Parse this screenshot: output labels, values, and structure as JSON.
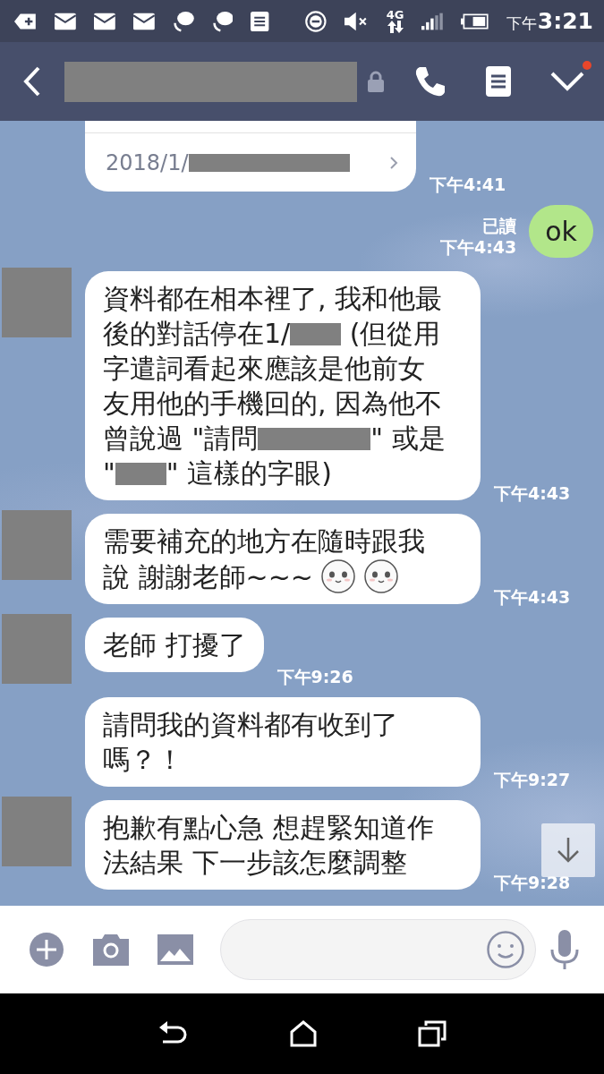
{
  "status_bar": {
    "network": "4G",
    "period": "下午",
    "time": "3:21"
  },
  "header": {
    "has_unread": true
  },
  "messages": [
    {
      "kind": "card",
      "avatar": false,
      "lines": [
        [
          {
            "kind": "text",
            "text": "2018/1/"
          },
          {
            "kind": "redacted_wide"
          }
        ]
      ],
      "time": "下午4:41"
    },
    {
      "kind": "outgoing",
      "read": "已讀",
      "lines": [
        [
          {
            "kind": "text",
            "text": "ok"
          }
        ]
      ],
      "time": "下午4:43"
    },
    {
      "kind": "incoming",
      "avatar": true,
      "lines": [
        [
          {
            "kind": "text",
            "text": "資料都在相本裡了, 我和他最"
          }
        ],
        [
          {
            "kind": "text",
            "text": "後的對話停在1/"
          },
          {
            "kind": "redacted_short"
          },
          {
            "kind": "text",
            "text": " (但從用"
          }
        ],
        [
          {
            "kind": "text",
            "text": "字遣詞看起來應該是他前女"
          }
        ],
        [
          {
            "kind": "text",
            "text": "友用他的手機回的, 因為他不"
          }
        ],
        [
          {
            "kind": "text",
            "text": "曾說過 \"請問"
          },
          {
            "kind": "redacted_long"
          },
          {
            "kind": "text",
            "text": "\" 或是"
          }
        ],
        [
          {
            "kind": "text",
            "text": "\""
          },
          {
            "kind": "redacted_short"
          },
          {
            "kind": "text",
            "text": "\" 這樣的字眼)"
          }
        ]
      ],
      "time": "下午4:43"
    },
    {
      "kind": "incoming",
      "avatar": true,
      "lines": [
        [
          {
            "kind": "text",
            "text": "需要補充的地方在隨時跟我"
          }
        ],
        [
          {
            "kind": "text",
            "text": "說 謝謝老師~~~"
          },
          {
            "kind": "emoji"
          },
          {
            "kind": "emoji"
          }
        ]
      ],
      "time": "下午4:43"
    },
    {
      "kind": "incoming",
      "avatar": true,
      "lines": [
        [
          {
            "kind": "text",
            "text": "老師 打擾了"
          }
        ]
      ],
      "time": "下午9:26"
    },
    {
      "kind": "incoming",
      "avatar": false,
      "lines": [
        [
          {
            "kind": "text",
            "text": "請問我的資料都有收到了"
          }
        ],
        [
          {
            "kind": "text",
            "text": "嗎？！"
          }
        ]
      ],
      "time": "下午9:27"
    },
    {
      "kind": "incoming",
      "avatar": true,
      "lines": [
        [
          {
            "kind": "text",
            "text": "抱歉有點心急 想趕緊知道作"
          }
        ],
        [
          {
            "kind": "text",
            "text": "法結果 下一步該怎麼調整"
          }
        ]
      ],
      "time": "下午9:28"
    }
  ]
}
